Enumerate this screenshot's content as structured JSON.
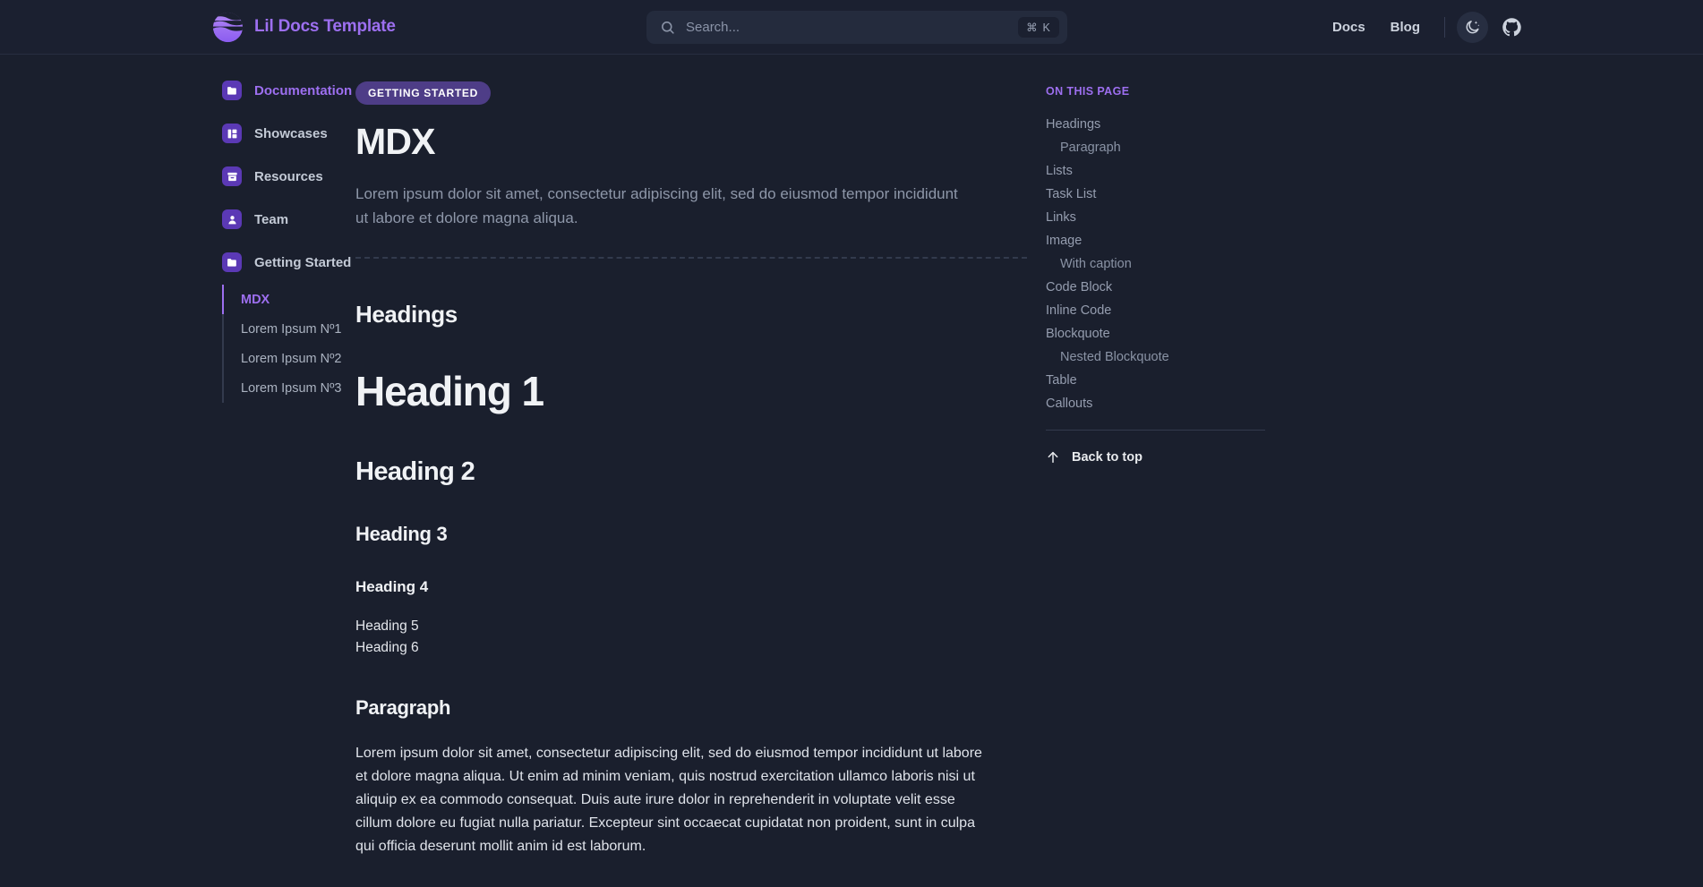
{
  "header": {
    "brand": "Lil Docs Template",
    "logo_icon": "wave-circle-logo",
    "search": {
      "placeholder": "Search...",
      "icon": "search-icon",
      "shortcut": "⌘ K"
    },
    "nav": [
      {
        "label": "Docs"
      },
      {
        "label": "Blog"
      }
    ],
    "theme_toggle_icon": "moon-sparkle-icon",
    "github_icon": "github-icon"
  },
  "sidebar": {
    "items": [
      {
        "label": "Documentation",
        "icon": "folder-icon",
        "active": true
      },
      {
        "label": "Showcases",
        "icon": "layout-panels-icon",
        "active": false
      },
      {
        "label": "Resources",
        "icon": "archive-box-icon",
        "active": false
      },
      {
        "label": "Team",
        "icon": "user-icon",
        "active": false
      },
      {
        "label": "Getting Started",
        "icon": "folder-filled-icon",
        "active": false
      }
    ],
    "sub_items": [
      {
        "label": "MDX",
        "active": true
      },
      {
        "label": "Lorem Ipsum Nº1",
        "active": false
      },
      {
        "label": "Lorem Ipsum Nº2",
        "active": false
      },
      {
        "label": "Lorem Ipsum Nº3",
        "active": false
      }
    ]
  },
  "main": {
    "badge": "GETTING STARTED",
    "title": "MDX",
    "intro": "Lorem ipsum dolor sit amet, consectetur adipiscing elit, sed do eiusmod tempor incididunt ut labore et dolore magna aliqua.",
    "headings_section": "Headings",
    "h1": "Heading 1",
    "h2": "Heading 2",
    "h3": "Heading 3",
    "h4": "Heading 4",
    "h5": "Heading 5",
    "h6": "Heading 6",
    "paragraph_section": "Paragraph",
    "paragraph_body": "Lorem ipsum dolor sit amet, consectetur adipiscing elit, sed do eiusmod tempor incididunt ut labore et dolore magna aliqua. Ut enim ad minim veniam, quis nostrud exercitation ullamco laboris nisi ut aliquip ex ea commodo consequat. Duis aute irure dolor in reprehenderit in voluptate velit esse cillum dolore eu fugiat nulla pariatur. Excepteur sint occaecat cupidatat non proident, sunt in culpa qui officia deserunt mollit anim id est laborum."
  },
  "toc": {
    "title": "ON THIS PAGE",
    "items": [
      {
        "label": "Headings",
        "level": 1
      },
      {
        "label": "Paragraph",
        "level": 2
      },
      {
        "label": "Lists",
        "level": 1
      },
      {
        "label": "Task List",
        "level": 1
      },
      {
        "label": "Links",
        "level": 1
      },
      {
        "label": "Image",
        "level": 1
      },
      {
        "label": "With caption",
        "level": 2
      },
      {
        "label": "Code Block",
        "level": 1
      },
      {
        "label": "Inline Code",
        "level": 1
      },
      {
        "label": "Blockquote",
        "level": 1
      },
      {
        "label": "Nested Blockquote",
        "level": 2
      },
      {
        "label": "Table",
        "level": 1
      },
      {
        "label": "Callouts",
        "level": 1
      }
    ],
    "back_to_top": "Back to top",
    "back_to_top_icon": "arrow-up-icon"
  },
  "colors": {
    "background": "#1a1f2d",
    "header_bg": "#1b2030",
    "accent_purple": "#9d6ff0",
    "icon_purple": "#5b39b5",
    "badge_bg": "#4e3d87"
  }
}
